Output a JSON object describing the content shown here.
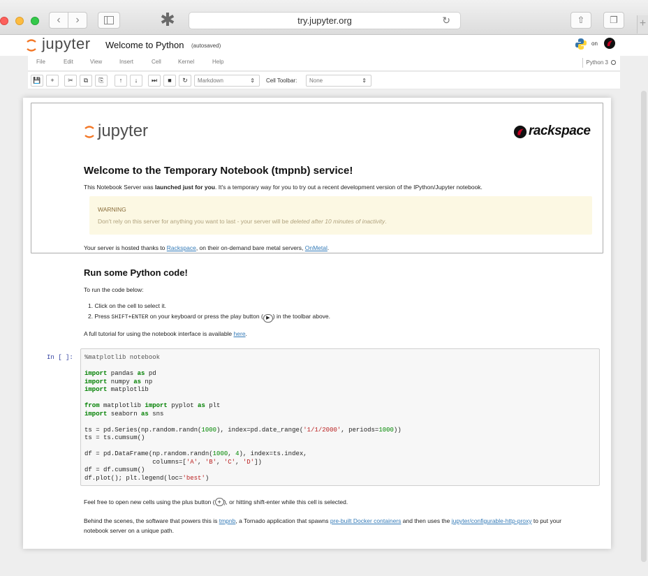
{
  "browser": {
    "url": "try.jupyter.org",
    "back_icon": "‹",
    "forward_icon": "›",
    "ext_icon": "✱",
    "reload_icon": "↻",
    "share_icon": "⇧",
    "tabs_icon": "❐",
    "newtab_icon": "+"
  },
  "header": {
    "logo_text": "jupyter",
    "notebook_title": "Welcome to Python",
    "autosave": "(autosaved)",
    "on_text": "on"
  },
  "menu": {
    "items": [
      "File",
      "Edit",
      "View",
      "Insert",
      "Cell",
      "Kernel",
      "Help"
    ],
    "kernel": "Python 3"
  },
  "toolbar": {
    "buttons": [
      "💾",
      "+",
      "✂",
      "⧉",
      "⎘",
      "↑",
      "↓",
      "⏭",
      "■",
      "↻"
    ],
    "cell_type": "Markdown",
    "cell_toolbar_label": "Cell Toolbar:",
    "cell_toolbar_value": "None"
  },
  "intro": {
    "logo_text": "jupyter",
    "rackspace_text": "rackspace",
    "heading": "Welcome to the Temporary Notebook (tmpnb) service!",
    "p1_a": "This Notebook Server was ",
    "p1_bold": "launched just for you",
    "p1_b": ". It's a temporary way for you to try out a recent development version of the IPython/Jupyter notebook.",
    "warning_title": "WARNING",
    "warning_a": "Don't rely on this server for anything you want to last - your server will be ",
    "warning_em": "deleted after 10 minutes of inactivity",
    "warning_b": ".",
    "host_a": "Your server is hosted thanks to ",
    "host_link1": "Rackspace",
    "host_b": ", on their on-demand bare metal servers, ",
    "host_link2": "OnMetal",
    "host_c": "."
  },
  "run": {
    "heading": "Run some Python code!",
    "intro": "To run the code below:",
    "step1": "1.  Click on the cell to select it.",
    "step2_a": "2.  Press ",
    "step2_kbd": "SHIFT+ENTER",
    "step2_b": " on your keyboard or press the play button (",
    "step2_icon": "▶",
    "step2_c": ") in the toolbar above.",
    "tutorial_a": "A full tutorial for using the notebook interface is available ",
    "tutorial_link": "here",
    "tutorial_b": "."
  },
  "cell": {
    "prompt": "In [ ]:"
  },
  "footer": {
    "feel_a": "Feel free to open new cells using the plus button (",
    "feel_icon": "+",
    "feel_b": "), or hitting shift-enter while this cell is selected.",
    "behind_a": "Behind the scenes, the software that powers this is ",
    "behind_link1": "tmpnb",
    "behind_b": ", a Tornado application that spawns ",
    "behind_link2": "pre-built Docker containers",
    "behind_c": " and then uses the ",
    "behind_link3": "jupyter/configurable-http-proxy",
    "behind_d": " to put your notebook server on a unique path."
  },
  "colors": {
    "jupyter_orange": "#f37726",
    "link": "#337ab7",
    "warning_bg": "#fcf8e3",
    "keyword": "#008000",
    "string": "#ba2121"
  }
}
